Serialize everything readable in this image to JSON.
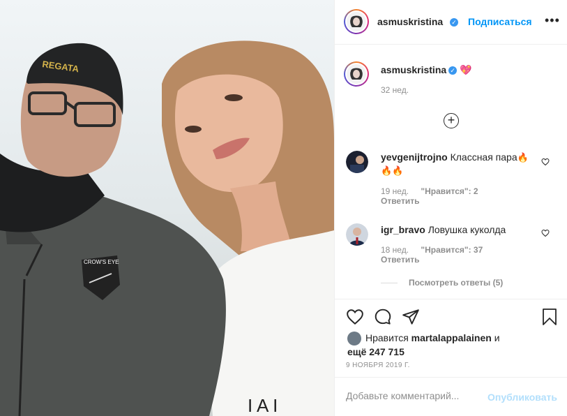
{
  "post": {
    "author": "asmuskristina",
    "follow_label": "Подписаться",
    "separator": "•",
    "more_label": "•••"
  },
  "caption": {
    "author": "asmuskristina",
    "emoji": "💖",
    "time": "32 нед."
  },
  "load_more_label": "+",
  "comments": [
    {
      "username": "yevgenijtrojno",
      "text": "Классная пара",
      "emoji_line1": "🔥",
      "emoji_line2": "🔥🔥",
      "time": "19 нед.",
      "likes": "\"Нравится\": 2",
      "reply_label": "Ответить"
    },
    {
      "username": "igr_bravo",
      "text": "Ловушка куколда",
      "time": "18 нед.",
      "likes": "\"Нравится\": 37",
      "reply_label": "Ответить"
    }
  ],
  "view_replies_label": "Посмотреть ответы (5)",
  "likes_info": {
    "prefix": "Нравится",
    "user": "martalappalainen",
    "conj": "и",
    "more": "ещё 247 715"
  },
  "date": "9 НОЯБРЯ 2019 Г.",
  "comment_form": {
    "placeholder": "Добавьте комментарий...",
    "publish_label": "Опубликовать"
  },
  "colors": {
    "link_blue": "#0095f6",
    "publish_disabled": "#b2dffc",
    "verified_blue": "#3897f0",
    "secondary_text": "#8e8e8e"
  },
  "icons": [
    "verified-icon",
    "more-icon",
    "add-circle-icon",
    "heart-icon",
    "comment-icon",
    "share-icon",
    "bookmark-icon"
  ]
}
